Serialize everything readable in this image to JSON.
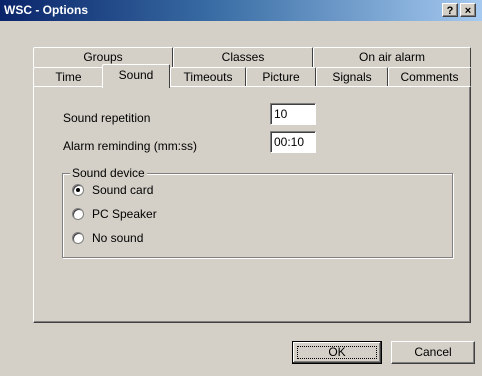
{
  "window": {
    "title": "WSC - Options",
    "help_label": "?",
    "close_label": "×"
  },
  "tabs_back": [
    "Groups",
    "Classes",
    "On air alarm"
  ],
  "tabs_front": [
    "Time",
    "Sound",
    "Timeouts",
    "Picture",
    "Signals",
    "Comments"
  ],
  "selected_tab": "Sound",
  "sound": {
    "repetition_label": "Sound repetition",
    "repetition_value": "10",
    "alarm_label": "Alarm reminding (mm:ss)",
    "alarm_value": "00:10"
  },
  "device": {
    "group_label": "Sound device",
    "options": [
      "Sound card",
      "PC Speaker",
      "No sound"
    ],
    "selected": "Sound card"
  },
  "buttons": {
    "ok_label": "OK",
    "cancel_label": "Cancel"
  },
  "colors": {
    "titlebar_start": "#0a246a",
    "titlebar_end": "#a6caf0",
    "face": "#d4d0c8"
  }
}
